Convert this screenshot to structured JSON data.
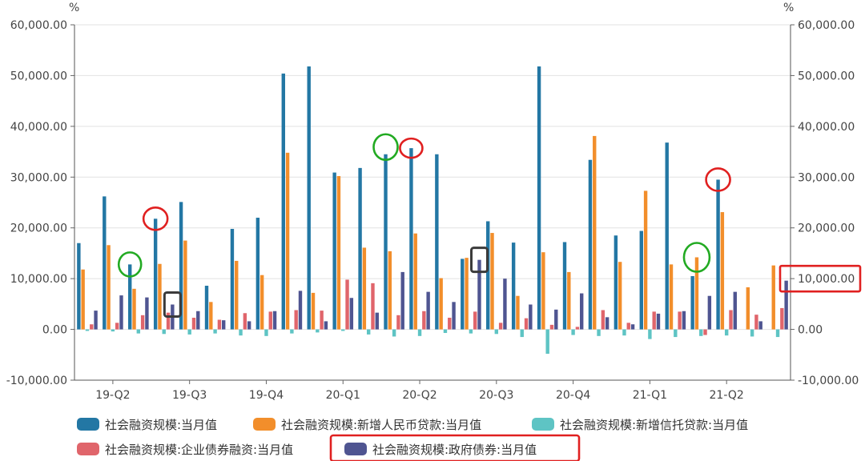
{
  "chart_data": {
    "type": "bar",
    "title": "",
    "y_unit_left": "%",
    "y_unit_right": "%",
    "ylim": [
      -10000,
      60000
    ],
    "y_ticks": [
      -10000,
      0,
      10000,
      20000,
      30000,
      40000,
      50000,
      60000
    ],
    "y_tick_labels": [
      "-10,000.00",
      "0.00",
      "10,000.00",
      "20,000.00",
      "30,000.00",
      "40,000.00",
      "50,000.00",
      "60,000.00"
    ],
    "grid": true,
    "legend_position": "bottom",
    "months": [
      "2019-04",
      "2019-05",
      "2019-06",
      "2019-07",
      "2019-08",
      "2019-09",
      "2019-10",
      "2019-11",
      "2019-12",
      "2020-01",
      "2020-02",
      "2020-03",
      "2020-04",
      "2020-05",
      "2020-06",
      "2020-07",
      "2020-08",
      "2020-09",
      "2020-10",
      "2020-11",
      "2020-12",
      "2021-01",
      "2021-02",
      "2021-03",
      "2021-04",
      "2021-05",
      "2021-06",
      "2021-07"
    ],
    "x_tick_labels": [
      {
        "label": "19-Q2",
        "month": "2019-05"
      },
      {
        "label": "19-Q3",
        "month": "2019-08"
      },
      {
        "label": "19-Q4",
        "month": "2019-11"
      },
      {
        "label": "20-Q1",
        "month": "2020-02"
      },
      {
        "label": "20-Q2",
        "month": "2020-05"
      },
      {
        "label": "20-Q3",
        "month": "2020-08"
      },
      {
        "label": "20-Q4",
        "month": "2020-11"
      },
      {
        "label": "21-Q1",
        "month": "2021-02"
      },
      {
        "label": "21-Q2",
        "month": "2021-05"
      }
    ],
    "series": [
      {
        "name": "社会融资规模:当月值",
        "color": "#2377a4",
        "values": [
          17000,
          26200,
          12800,
          21800,
          25100,
          8600,
          19800,
          22000,
          50400,
          51800,
          30900,
          31800,
          34500,
          35700,
          34500,
          13900,
          21300,
          17100,
          51800,
          17200,
          33400,
          18500,
          19400,
          36800,
          10500,
          29500,
          null,
          null
        ]
      },
      {
        "name": "社会融资规模:新增人民币贷款:当月值",
        "color": "#f28e2b",
        "values": [
          11800,
          16600,
          8000,
          12900,
          17500,
          5400,
          13500,
          10700,
          34800,
          7200,
          30200,
          16100,
          15400,
          18900,
          10100,
          14100,
          19000,
          6600,
          15200,
          11300,
          38100,
          13300,
          27300,
          12800,
          14200,
          23100,
          8300,
          12600
        ]
      },
      {
        "name": "社会融资规模:新增信托贷款:当月值",
        "color": "#5ec4c4",
        "values": [
          -300,
          -400,
          -800,
          -900,
          -1000,
          -800,
          -1200,
          -1300,
          -800,
          -600,
          -300,
          -1000,
          -1400,
          -1300,
          -700,
          -800,
          -900,
          -1500,
          -4800,
          -1100,
          -1300,
          -1200,
          -1900,
          -1500,
          -1300,
          -1200,
          -1400,
          -1500
        ]
      },
      {
        "name": "社会融资规模:企业债券融资:当月值",
        "color": "#e0656b",
        "values": [
          1000,
          1300,
          2800,
          3300,
          2300,
          1900,
          3200,
          3500,
          3800,
          3700,
          9800,
          9100,
          2800,
          3600,
          2300,
          3500,
          1300,
          2200,
          900,
          500,
          3800,
          1300,
          3500,
          3500,
          -1100,
          3800,
          2900,
          4200
        ]
      },
      {
        "name": "社会融资规模:政府债券:当月值",
        "color": "#4f5591",
        "values": [
          3700,
          6700,
          6300,
          4900,
          3600,
          1800,
          1600,
          3600,
          7600,
          1600,
          6200,
          3300,
          11300,
          7400,
          5400,
          13700,
          10000,
          4900,
          3900,
          7100,
          2400,
          1000,
          3100,
          3600,
          6600,
          7400,
          1600,
          9600
        ]
      }
    ]
  }
}
